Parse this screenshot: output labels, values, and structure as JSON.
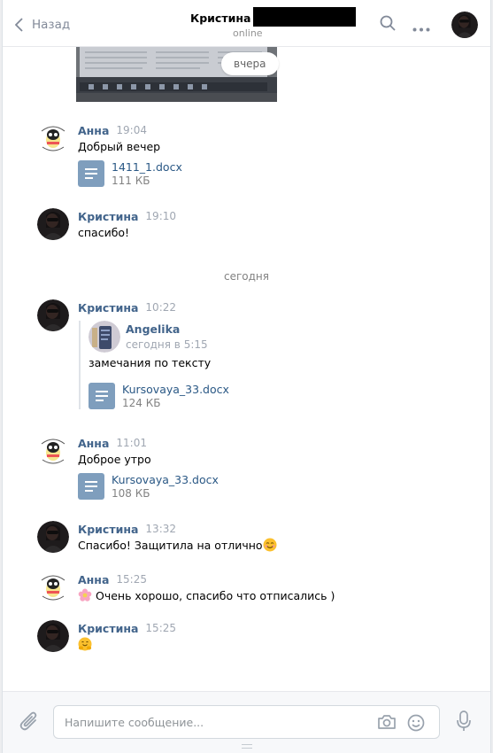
{
  "header": {
    "back_label": "Назад",
    "title": "Кристина",
    "status": "online"
  },
  "photo_message": {
    "date_badge": "вчера"
  },
  "day_separator": "сегодня",
  "messages": [
    {
      "author": "Анна",
      "time": "19:04",
      "text": "Добрый вечер",
      "doc": {
        "name": "1411_1.docx",
        "size": "111 КБ"
      }
    },
    {
      "author": "Кристина",
      "time": "19:10",
      "text": "спасибо!"
    },
    {
      "author": "Кристина",
      "time": "10:22",
      "forward": {
        "author": "Angelika",
        "time": "сегодня в 5:15",
        "text": "замечания по тексту",
        "doc": {
          "name": "Kursovaya_33.docx",
          "size": "124 КБ"
        }
      }
    },
    {
      "author": "Анна",
      "time": "11:01",
      "text": "Доброе утро",
      "doc": {
        "name": "Kursovaya_33.docx",
        "size": "108 КБ"
      }
    },
    {
      "author": "Кристина",
      "time": "13:32",
      "text": "Спасибо! Защитила на отлично",
      "emoji": "smiling-face-emoji"
    },
    {
      "author": "Анна",
      "time": "15:25",
      "text": "Очень хорошо, спасибо что отписались )",
      "emoji": "flower-emoji"
    },
    {
      "author": "Кристина",
      "time": "15:25",
      "text": "",
      "emoji": "hugging-face-emoji"
    }
  ],
  "composer": {
    "placeholder": "Напишите сообщение..."
  },
  "colors": {
    "author": "#42648b",
    "doc_link": "#2a5885",
    "doc_icon": "#7f9ebd",
    "time": "#a0a7b2"
  }
}
